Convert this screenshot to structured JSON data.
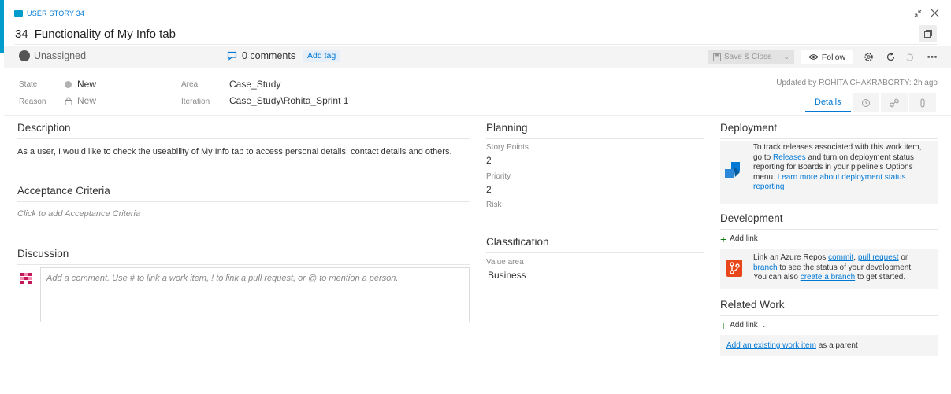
{
  "header": {
    "work_item_type": "USER STORY 34",
    "id": "34",
    "title": "Functionality of My Info tab"
  },
  "toolbar": {
    "assignee": "Unassigned",
    "comments": "0 comments",
    "add_tag": "Add tag",
    "save_close": "Save & Close",
    "follow": "Follow"
  },
  "fields": {
    "state_label": "State",
    "state_value": "New",
    "reason_label": "Reason",
    "reason_value": "New",
    "area_label": "Area",
    "area_value": "Case_Study",
    "iteration_label": "Iteration",
    "iteration_value": "Case_Study\\Rohita_Sprint 1",
    "updated": "Updated by ROHITA CHAKRABORTY: 2h ago"
  },
  "tabs": {
    "details": "Details"
  },
  "description": {
    "heading": "Description",
    "text": "As a user, I would like to check the useability of My Info tab to access personal details, contact details and others."
  },
  "acceptance": {
    "heading": "Acceptance Criteria",
    "placeholder": "Click to add Acceptance Criteria"
  },
  "discussion": {
    "heading": "Discussion",
    "placeholder": "Add a comment. Use # to link a work item, ! to link a pull request, or @ to mention a person."
  },
  "planning": {
    "heading": "Planning",
    "story_points_label": "Story Points",
    "story_points": "2",
    "priority_label": "Priority",
    "priority": "2",
    "risk_label": "Risk"
  },
  "classification": {
    "heading": "Classification",
    "value_area_label": "Value area",
    "value_area": "Business"
  },
  "deployment": {
    "heading": "Deployment",
    "t1": "To track releases associated with this work item,",
    "t2": "go to ",
    "releases_link": "Releases",
    "t3": " and turn on deployment status",
    "t4": "reporting for Boards in your pipeline's Options",
    "t5": "menu. ",
    "learn_more": "Learn more about deployment status",
    "learn_more2": "reporting"
  },
  "development": {
    "heading": "Development",
    "add_link": "Add link",
    "t1": "Link an Azure Repos ",
    "commit": "commit",
    "comma": ", ",
    "pull_request": "pull request",
    "or": " or",
    "branch": "branch",
    "t2": " to see the status of your development.",
    "t3": "You can also ",
    "create_branch": "create a branch",
    "t4": " to get started."
  },
  "related": {
    "heading": "Related Work",
    "add_link": "Add link",
    "existing_link": "Add an existing work item",
    "as_parent": " as a parent"
  },
  "colors": {
    "accent": "#009ccc",
    "link": "#0078d4"
  }
}
